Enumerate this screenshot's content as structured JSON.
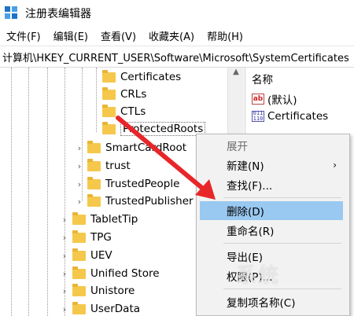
{
  "window": {
    "title": "注册表编辑器"
  },
  "menubar": [
    "文件(F)",
    "编辑(E)",
    "查看(V)",
    "收藏夹(A)",
    "帮助(H)"
  ],
  "address": "计算机\\HKEY_CURRENT_USER\\Software\\Microsoft\\SystemCertificates",
  "tree": {
    "children_of_selected_parent": [
      "Certificates",
      "CRLs",
      "CTLs",
      "ProtectedRoots"
    ],
    "siblings": [
      "SmartCardRoot",
      "trust",
      "TrustedPeople",
      "TrustedPublisher"
    ],
    "microsoft_children": [
      "TabletTip",
      "TPG",
      "UEV",
      "Unified Store",
      "Unistore",
      "UserData"
    ],
    "expander_glyph": "›"
  },
  "right_pane": {
    "header": "名称",
    "values": [
      {
        "icon": "ab",
        "name": "(默认)"
      },
      {
        "icon": "binary",
        "name": "Certificates"
      }
    ]
  },
  "context_menu": {
    "header": "展开",
    "new": "新建(N)",
    "find": "查找(F)...",
    "delete": "删除(D)",
    "rename": "重命名(R)",
    "export": "导出(E)",
    "permissions": "权限(P)...",
    "copy_key_name": "复制项名称(C)",
    "submenu_arrow": "›"
  },
  "watermark": "系统",
  "colors": {
    "highlight": "#99c8f0",
    "folder": "#f5c84c",
    "arrow": "#e8262a"
  }
}
